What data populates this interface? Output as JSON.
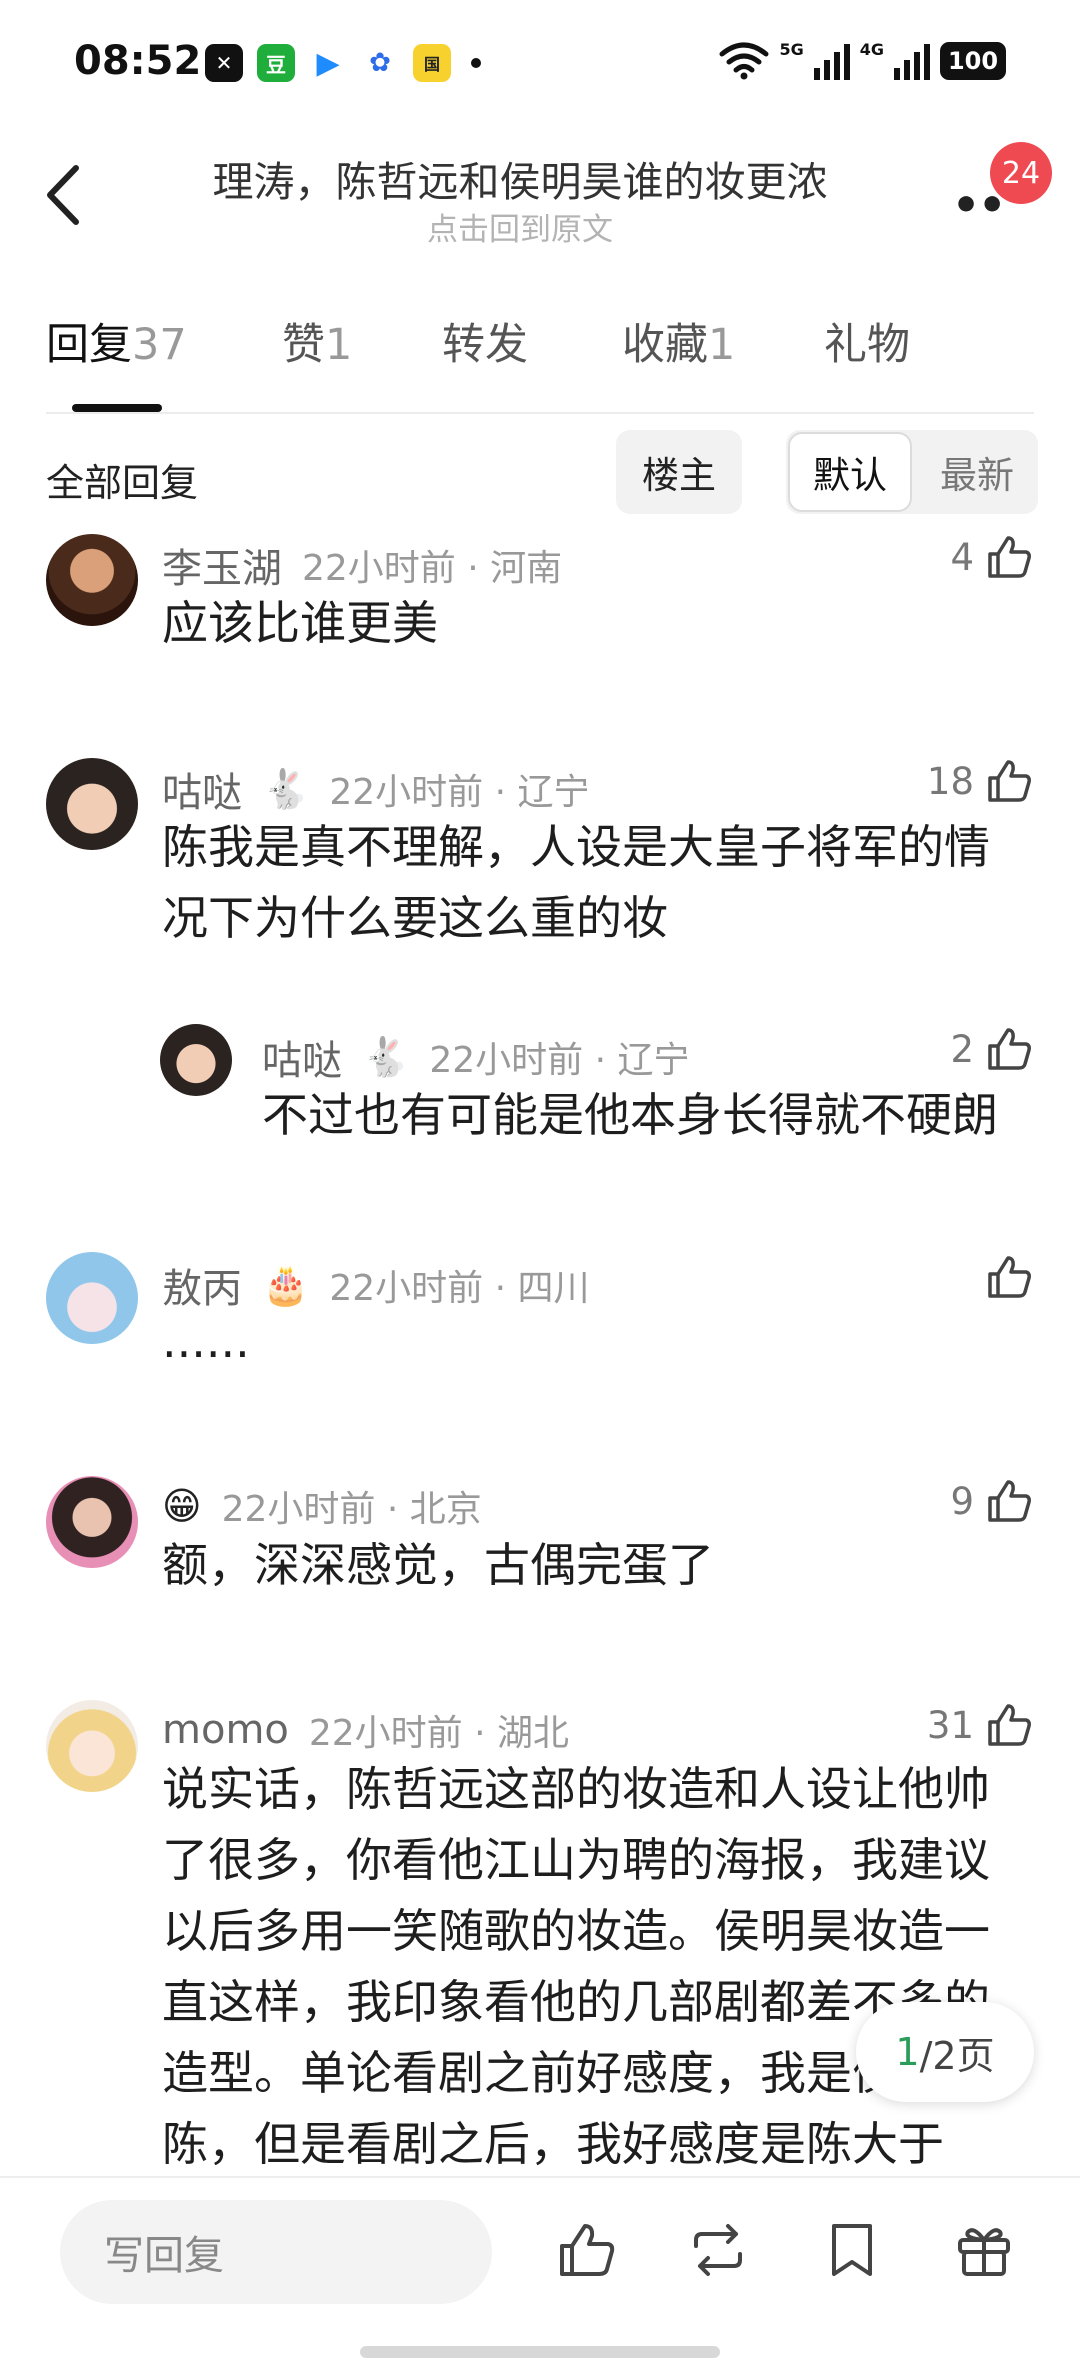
{
  "status": {
    "time": "08:52",
    "apps": [
      "capcut-icon",
      "douban-icon",
      "play-icon",
      "baidu-icon",
      "guoman-icon"
    ],
    "net1": "5G",
    "net2": "4G",
    "battery": "100"
  },
  "header": {
    "title": "理涛，陈哲远和侯明昊谁的妆更浓",
    "subtitle": "点击回到原文",
    "notif_count": "24"
  },
  "tabs": [
    {
      "label": "回复",
      "count": "37"
    },
    {
      "label": "赞",
      "count": "1"
    },
    {
      "label": "转发",
      "count": ""
    },
    {
      "label": "收藏",
      "count": "1"
    },
    {
      "label": "礼物",
      "count": ""
    }
  ],
  "filter": {
    "all": "全部回复",
    "op": "楼主",
    "default": "默认",
    "newest": "最新"
  },
  "comments": [
    {
      "user": "李玉湖",
      "emoji": "",
      "time": "22小时前 · 河南",
      "likes": "4",
      "text": "应该比谁更美"
    },
    {
      "user": "咕哒",
      "emoji": "🐇",
      "time": "22小时前 · 辽宁",
      "likes": "18",
      "text_lines": [
        "陈我是真不理解，人设是大皇子将军的情",
        "况下为什么要这么重的妆"
      ]
    },
    {
      "user": "咕哒",
      "emoji": "🐇",
      "time": "22小时前 · 辽宁",
      "likes": "2",
      "text": "不过也有可能是他本身长得就不硬朗"
    },
    {
      "user": "敖丙",
      "emoji": "🎂",
      "time": "22小时前 · 四川",
      "likes": "",
      "text": "......"
    },
    {
      "user": "",
      "emoji": "😁",
      "time": "22小时前 · 北京",
      "likes": "9",
      "text": "额，深深感觉，古偶完蛋了"
    },
    {
      "user": "momo",
      "emoji": "",
      "time": "22小时前 · 湖北",
      "likes": "31",
      "text_lines": [
        "说实话，陈哲远这部的妆造和人设让他帅",
        "了很多，你看他江山为聘的海报，我建议",
        "以后多用一笑随歌的妆造。侯明昊妆造一",
        "直这样，我印象看他的几部剧都差不多的",
        "造型。单论看剧之前好感度，我是侯大于",
        "陈，但是看剧之后，我好感度是陈大于"
      ]
    }
  ],
  "pager": {
    "current": "1",
    "total": "/2页"
  },
  "bottom": {
    "reply_placeholder": "写回复"
  }
}
